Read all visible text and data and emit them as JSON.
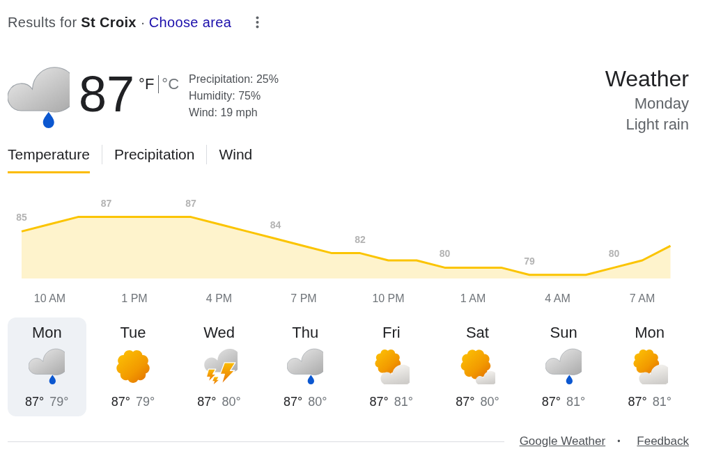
{
  "results": {
    "text": "Results for **St Croix** ·",
    "link": "Choose area"
  },
  "current": {
    "kind": "rain",
    "temperature": "87",
    "units": [
      {
        "label": "°F",
        "selected": true
      },
      {
        "label": "°C",
        "selected": false
      }
    ],
    "details": [
      "Precipitation: 25%",
      "Humidity: 75%",
      "Wind: 19 mph"
    ]
  },
  "summary": {
    "title": "Weather",
    "day": "Monday",
    "condition": "Light rain"
  },
  "tabs": [
    {
      "label": "Temperature",
      "selected": true
    },
    {
      "label": "Precipitation",
      "selected": false
    },
    {
      "label": "Wind",
      "selected": false
    }
  ],
  "chart": {
    "chart_data": {
      "type": "area",
      "categories": [
        null,
        "10 AM",
        null,
        null,
        "1 PM",
        null,
        null,
        "4 PM",
        null,
        null,
        "7 PM",
        null,
        null,
        "10 PM",
        null,
        null,
        "1 AM",
        null,
        null,
        "4 AM",
        null,
        null,
        "7 AM",
        null
      ],
      "series": [
        {
          "color": "#fbc400",
          "values": [
            85,
            86,
            87,
            87,
            87,
            87,
            87,
            86,
            85,
            84,
            83,
            82,
            82,
            81,
            81,
            80,
            80,
            80,
            79,
            79,
            79,
            80,
            81,
            83
          ],
          "value_labels": [
            "85",
            null,
            null,
            "87",
            null,
            null,
            "87",
            null,
            null,
            "84",
            null,
            null,
            "82",
            null,
            null,
            "80",
            null,
            null,
            "79",
            null,
            null,
            "80",
            null,
            null
          ]
        }
      ]
    }
  },
  "forecast": [
    {
      "day": "Mon",
      "kind": "rain",
      "high": "87°",
      "low": "79°",
      "selected": true
    },
    {
      "day": "Tue",
      "kind": "sunny",
      "high": "87°",
      "low": "79°",
      "selected": false
    },
    {
      "day": "Wed",
      "kind": "thunderstorm",
      "high": "87°",
      "low": "80°",
      "selected": false
    },
    {
      "day": "Thu",
      "kind": "rain",
      "high": "87°",
      "low": "80°",
      "selected": false
    },
    {
      "day": "Fri",
      "kind": "partly_cloudy",
      "high": "87°",
      "low": "81°",
      "selected": false
    },
    {
      "day": "Sat",
      "kind": "mostly_sunny",
      "high": "87°",
      "low": "80°",
      "selected": false
    },
    {
      "day": "Sun",
      "kind": "rain",
      "high": "87°",
      "low": "81°",
      "selected": false
    },
    {
      "day": "Mon",
      "kind": "partly_cloudy",
      "high": "87°",
      "low": "81°",
      "selected": false
    }
  ],
  "footer": {
    "links": [
      "Google Weather",
      "Feedback"
    ],
    "separator": "•"
  }
}
